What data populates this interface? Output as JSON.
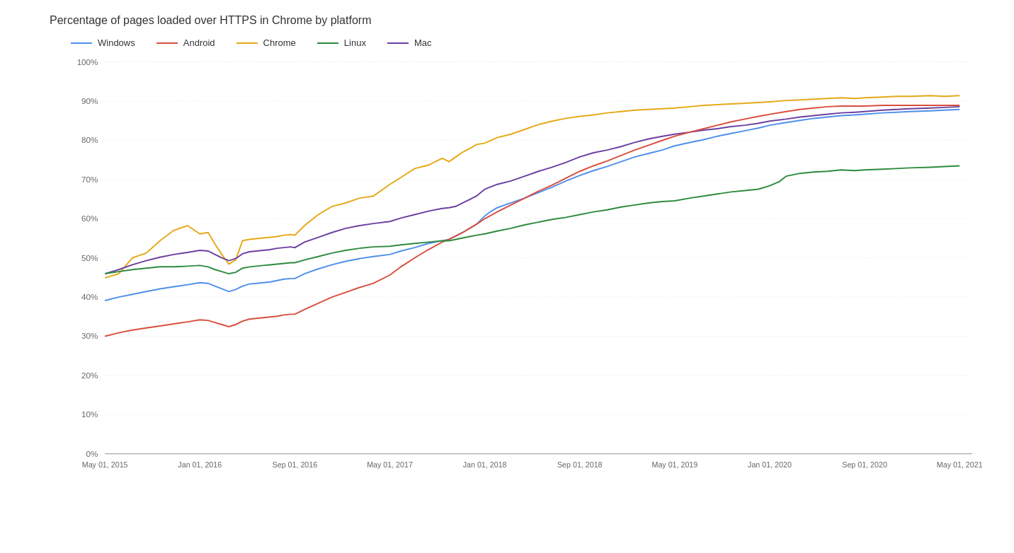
{
  "title": "Percentage of pages loaded over HTTPS in Chrome by platform",
  "legend": [
    {
      "label": "Windows",
      "color": "#4e8fea"
    },
    {
      "label": "Android",
      "color": "#d94d3d"
    },
    {
      "label": "Chrome",
      "color": "#e6a817"
    },
    {
      "label": "Linux",
      "color": "#2d8a3e"
    },
    {
      "label": "Mac",
      "color": "#6a3fa0"
    }
  ],
  "yAxis": {
    "labels": [
      "0%",
      "10%",
      "20%",
      "30%",
      "40%",
      "50%",
      "60%",
      "70%",
      "80%",
      "90%",
      "100%"
    ]
  },
  "xAxis": {
    "labels": [
      "May 01, 2015",
      "Jan 01, 2016",
      "Sep 01, 2016",
      "May 01, 2017",
      "Jan 01, 2018",
      "Sep 01, 2018",
      "May 01, 2019",
      "Jan 01, 2020",
      "Sep 01, 2020",
      "May 01, 2021"
    ]
  },
  "colors": {
    "windows": "#4e8fea",
    "android": "#d94d3d",
    "chrome": "#e6a817",
    "linux": "#2d8a3e",
    "mac": "#6a3fa0"
  }
}
